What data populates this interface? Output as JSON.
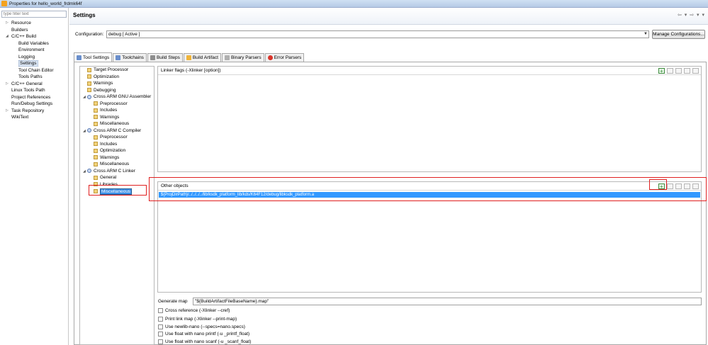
{
  "window": {
    "title": "Properties for hello_world_frdmk64f"
  },
  "left": {
    "filter_placeholder": "type filter text",
    "items": [
      {
        "label": "Resource",
        "indent": 1,
        "arrow": "▷"
      },
      {
        "label": "Builders",
        "indent": 1,
        "arrow": ""
      },
      {
        "label": "C/C++ Build",
        "indent": 1,
        "arrow": "◢"
      },
      {
        "label": "Build Variables",
        "indent": 2,
        "arrow": ""
      },
      {
        "label": "Environment",
        "indent": 2,
        "arrow": ""
      },
      {
        "label": "Logging",
        "indent": 2,
        "arrow": ""
      },
      {
        "label": "Settings",
        "indent": 2,
        "arrow": "",
        "selected": true
      },
      {
        "label": "Tool Chain Editor",
        "indent": 2,
        "arrow": ""
      },
      {
        "label": "Tools Paths",
        "indent": 2,
        "arrow": ""
      },
      {
        "label": "C/C++ General",
        "indent": 1,
        "arrow": "▷"
      },
      {
        "label": "Linux Tools Path",
        "indent": 1,
        "arrow": ""
      },
      {
        "label": "Project References",
        "indent": 1,
        "arrow": ""
      },
      {
        "label": "Run/Debug Settings",
        "indent": 1,
        "arrow": ""
      },
      {
        "label": "Task Repository",
        "indent": 1,
        "arrow": "▷"
      },
      {
        "label": "WikiText",
        "indent": 1,
        "arrow": ""
      }
    ]
  },
  "header": {
    "title": "Settings",
    "nav": "⇦ ▾ ⇨ ▾ ▾"
  },
  "config": {
    "label": "Configuration:",
    "value": "debug  [ Active ]",
    "manage_label": "Manage Configurations..."
  },
  "tabs": [
    {
      "label": "Tool Settings",
      "active": true,
      "color": "#6a8fcc"
    },
    {
      "label": "Toolchains",
      "color": "#6a8fcc"
    },
    {
      "label": "Build Steps",
      "color": "#8e8e8e"
    },
    {
      "label": "Build Artifact",
      "color": "#f0b43a"
    },
    {
      "label": "Binary Parsers",
      "color": "#b0b0b0"
    },
    {
      "label": "Error Parsers",
      "color": "#d9352b"
    }
  ],
  "tool_tree": [
    {
      "label": "Target Processor",
      "level": 1,
      "icon": "item"
    },
    {
      "label": "Optimization",
      "level": 1,
      "icon": "item"
    },
    {
      "label": "Warnings",
      "level": 1,
      "icon": "item"
    },
    {
      "label": "Debugging",
      "level": 1,
      "icon": "item"
    },
    {
      "label": "Cross ARM GNU Assembler",
      "level": 0,
      "icon": "gear"
    },
    {
      "label": "Preprocessor",
      "level": 2,
      "icon": "item"
    },
    {
      "label": "Includes",
      "level": 2,
      "icon": "item"
    },
    {
      "label": "Warnings",
      "level": 2,
      "icon": "item"
    },
    {
      "label": "Miscellaneous",
      "level": 2,
      "icon": "item"
    },
    {
      "label": "Cross ARM C Compiler",
      "level": 0,
      "icon": "gear"
    },
    {
      "label": "Preprocessor",
      "level": 2,
      "icon": "item"
    },
    {
      "label": "Includes",
      "level": 2,
      "icon": "item"
    },
    {
      "label": "Optimization",
      "level": 2,
      "icon": "item"
    },
    {
      "label": "Warnings",
      "level": 2,
      "icon": "item"
    },
    {
      "label": "Miscellaneous",
      "level": 2,
      "icon": "item"
    },
    {
      "label": "Cross ARM C Linker",
      "level": 0,
      "icon": "gear"
    },
    {
      "label": "General",
      "level": 2,
      "icon": "item"
    },
    {
      "label": "Libraries",
      "level": 2,
      "icon": "item"
    },
    {
      "label": "Miscellaneous",
      "level": 2,
      "icon": "item",
      "selected": true
    }
  ],
  "linker_flags": {
    "label": "Linker flags (-Xlinker [option])"
  },
  "other_objects": {
    "label": "Other objects",
    "items": [
      "${ProjDirPath}/../../../../lib/ksdk_platform_lib/kds/K64F12/debug/libksdk_platform.a"
    ]
  },
  "generate_map": {
    "label": "Generate map",
    "value": "\"${BuildArtifactFileBaseName}.map\""
  },
  "checkboxes": [
    {
      "label": "Cross reference (-Xlinker --cref)"
    },
    {
      "label": "Print link map (-Xlinker --print-map)"
    },
    {
      "label": "Use newlib-nano (--specs=nano.specs)"
    },
    {
      "label": "Use float with nano printf (-u _printf_float)"
    },
    {
      "label": "Use float with nano scanf (-u _scanf_float)"
    }
  ]
}
